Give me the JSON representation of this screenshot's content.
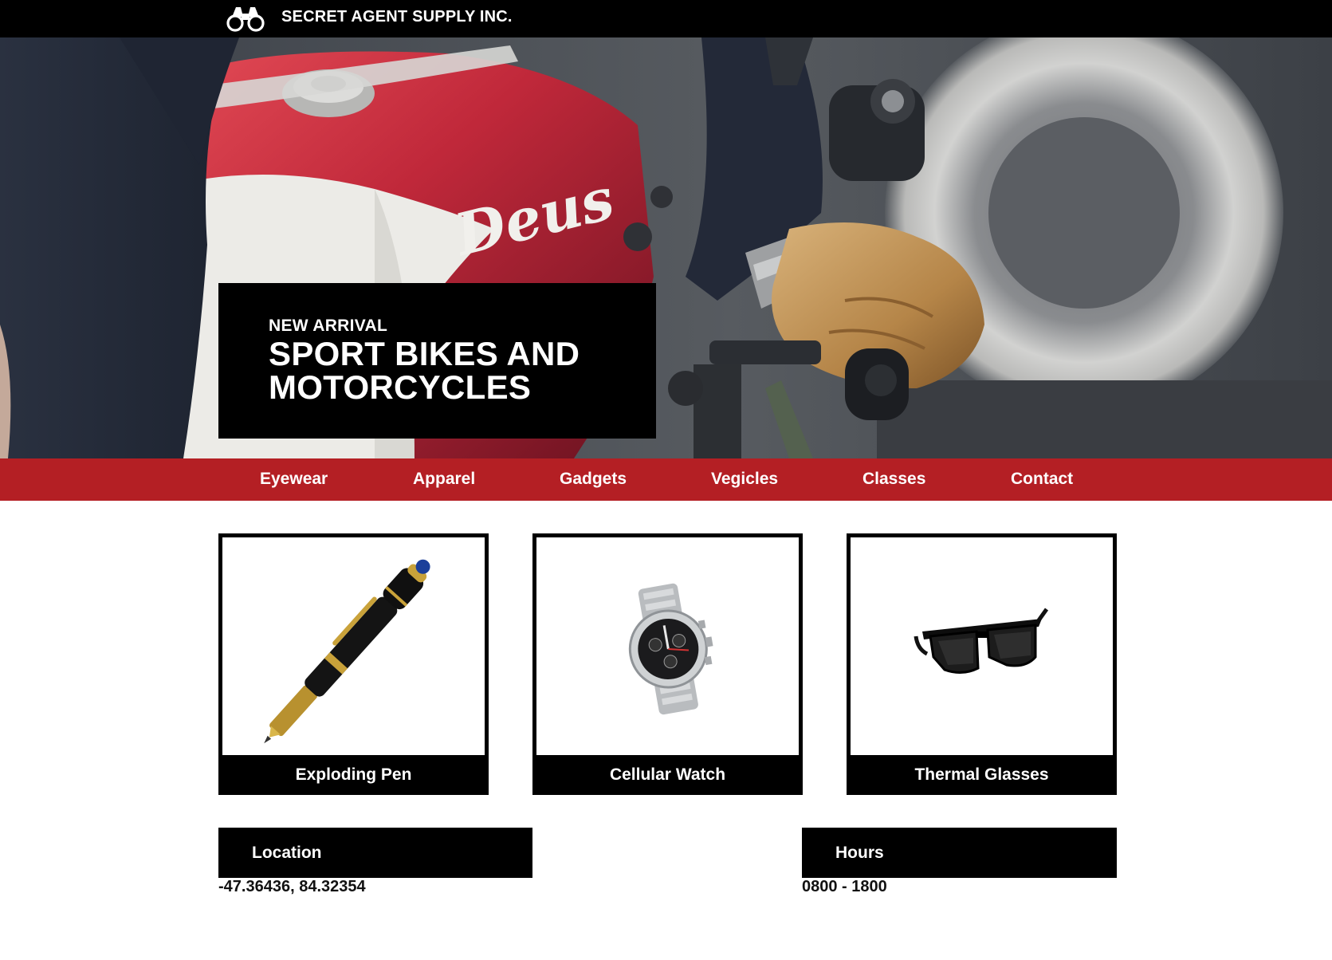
{
  "header": {
    "brand": "SECRET AGENT SUPPLY INC.",
    "logo_icon": "binoculars-icon"
  },
  "hero": {
    "eyebrow": "NEW ARRIVAL",
    "title": "SPORT BIKES AND MOTORCYCLES",
    "image_subject": "rider gloved hand on red motorcycle handlebar",
    "tank_lettering": "Deus"
  },
  "nav": {
    "items": [
      {
        "label": "Eyewear"
      },
      {
        "label": "Apparel"
      },
      {
        "label": "Gadgets"
      },
      {
        "label": "Vegicles"
      },
      {
        "label": "Classes"
      },
      {
        "label": "Contact"
      }
    ]
  },
  "products": [
    {
      "name": "Exploding Pen",
      "icon": "pen-icon"
    },
    {
      "name": "Cellular Watch",
      "icon": "watch-icon"
    },
    {
      "name": "Thermal Glasses",
      "icon": "sunglasses-icon"
    }
  ],
  "info": {
    "location": {
      "label": "Location",
      "value": "-47.36436, 84.32354"
    },
    "hours": {
      "label": "Hours",
      "value": "0800 - 1800"
    }
  },
  "colors": {
    "brand_red": "#b41f24",
    "black": "#000000",
    "white": "#ffffff"
  }
}
